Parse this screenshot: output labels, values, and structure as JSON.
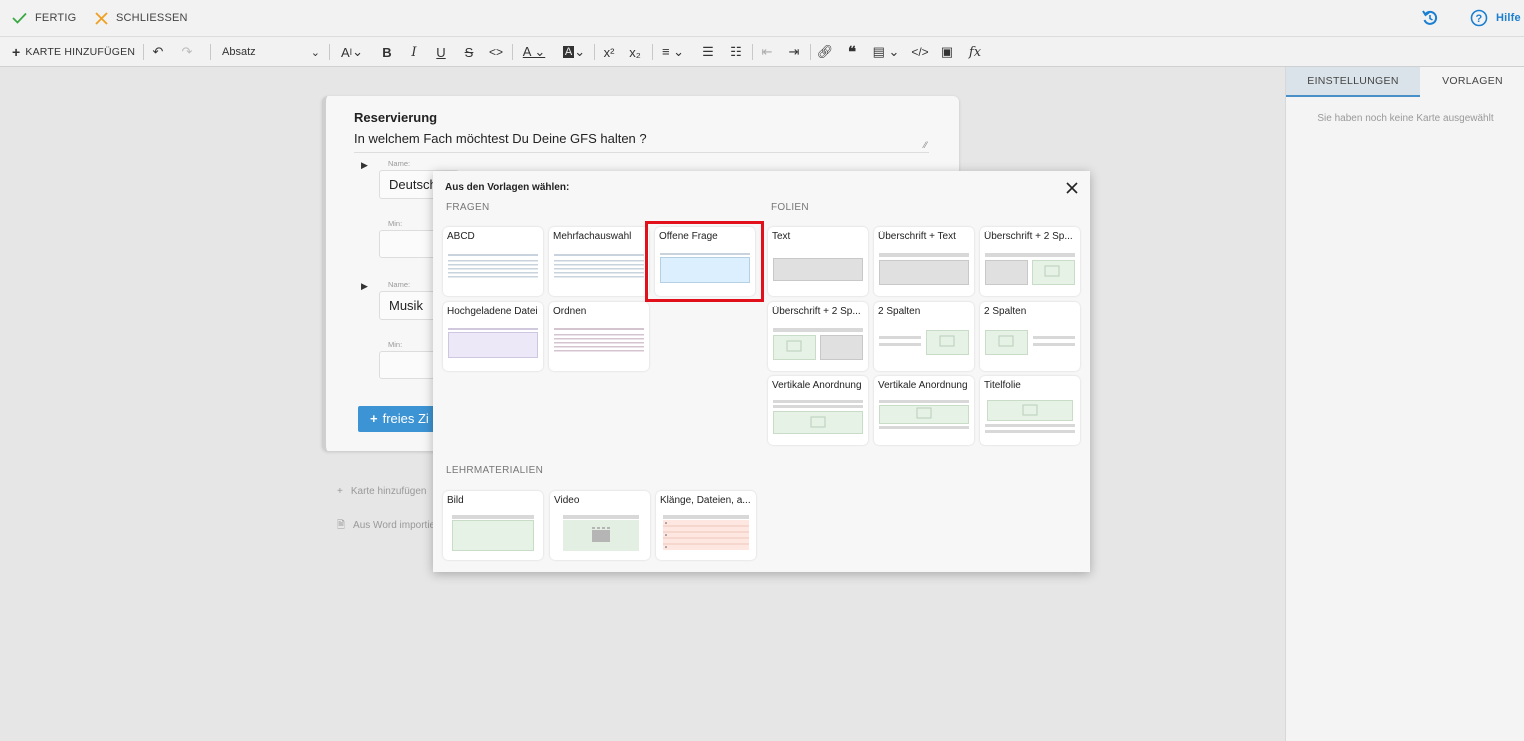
{
  "topbar": {
    "done_label": "FERTIG",
    "close_label": "SCHLIESSEN",
    "help_label": "Hilfe"
  },
  "toolbar": {
    "add_card_label": "KARTE HINZUFÜGEN",
    "paragraph_select": "Absatz"
  },
  "right_panel": {
    "tabs": [
      "EINSTELLUNGEN",
      "VORLAGEN"
    ],
    "empty_message": "Sie haben noch keine Karte ausgewählt"
  },
  "card": {
    "title": "Reservierung",
    "question": "In welchem Fach möchtest Du Deine GFS halten ?",
    "entries": [
      {
        "name_label": "Name:",
        "name_value": "Deutsch",
        "min_label": "Min:"
      },
      {
        "name_label": "Name:",
        "name_value": "Musik",
        "min_label": "Min:"
      }
    ],
    "free_button": "freies Zi",
    "add_card_link": "Karte hinzufügen",
    "import_word_link": "Aus Word importie"
  },
  "modal": {
    "title": "Aus den Vorlagen wählen:",
    "sections": {
      "questions": "FRAGEN",
      "slides": "FOLIEN",
      "materials": "LEHRMATERIALIEN"
    },
    "questions": [
      "ABCD",
      "Mehrfachauswahl",
      "Offene Frage",
      "Hochgeladene Datei",
      "Ordnen"
    ],
    "slides": [
      "Text",
      "Überschrift + Text",
      "Überschrift + 2 Sp...",
      "Überschrift + 2 Sp...",
      "2 Spalten",
      "2 Spalten",
      "Vertikale Anordnung",
      "Vertikale Anordnung",
      "Titelfolie"
    ],
    "materials": [
      "Bild",
      "Video",
      "Klänge, Dateien, a..."
    ],
    "highlighted": "Offene Frage"
  },
  "colors": {
    "accent": "#3d94d4",
    "highlight": "#e2101a",
    "done_check": "#3aa843",
    "close_x": "#f0a020"
  }
}
